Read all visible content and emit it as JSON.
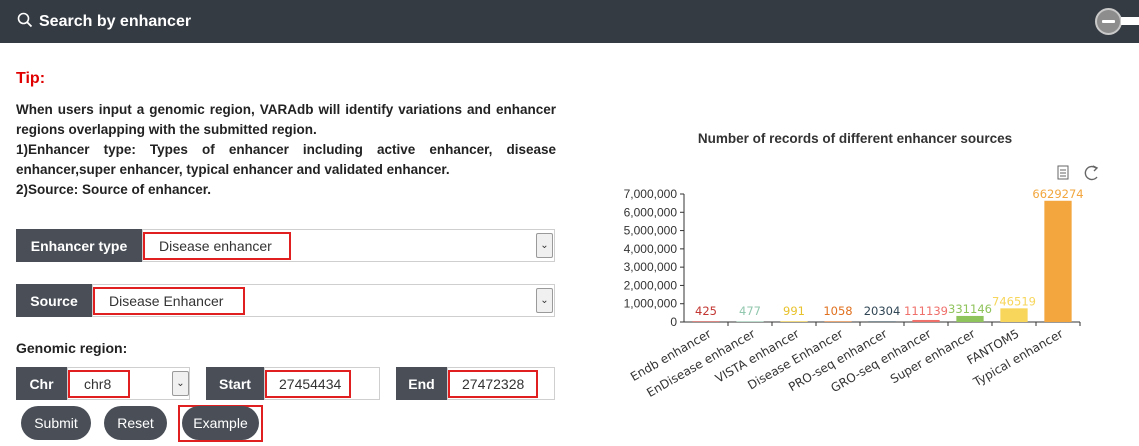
{
  "header": {
    "title": "Search by enhancer"
  },
  "tip": {
    "title": "Tip:",
    "lines": [
      "When users input a genomic region, VARAdb will identify variations and enhancer regions overlapping with the submitted region.",
      "1)Enhancer type: Types of enhancer including active enhancer, disease enhancer,super enhancer, typical enhancer and validated enhancer.",
      "2)Source: Source of enhancer."
    ]
  },
  "form": {
    "enhancer_type": {
      "label": "Enhancer type",
      "value": "Disease enhancer"
    },
    "source": {
      "label": "Source",
      "value": "Disease Enhancer"
    },
    "genomic_region_label": "Genomic region:",
    "chr": {
      "label": "Chr",
      "value": "chr8"
    },
    "start": {
      "label": "Start",
      "value": "27454434"
    },
    "end": {
      "label": "End",
      "value": "27472328"
    }
  },
  "buttons": {
    "submit": "Submit",
    "reset": "Reset",
    "example": "Example"
  },
  "icons": {
    "search": "search-icon",
    "collapse": "minus-circle-icon",
    "data_view": "document-icon",
    "restore": "refresh-icon",
    "dropdown": "chevron-down-icon"
  },
  "colors": {
    "header_bg": "#353b43",
    "label_bg": "#4a4f57",
    "highlight": "#e02020",
    "tip": "#e00000"
  },
  "chart_data": {
    "type": "bar",
    "title": "Number of records of different enhancer sources",
    "categories": [
      "Endb enhancer",
      "EnDisease enhancer",
      "VISTA enhancer",
      "Disease Enhancer",
      "PRO-seq  enhancer",
      "GRO-seq enhancer",
      "Super enhancer",
      "FANTOM5",
      "Typical enhancer"
    ],
    "values": [
      425,
      477,
      991,
      1058,
      20304,
      111139,
      331146,
      746519,
      6629274
    ],
    "colors": [
      "#c23531",
      "#91c7ae",
      "#e8c22c",
      "#e0701f",
      "#2f4554",
      "#ef6f6a",
      "#8fc35b",
      "#f7d65b",
      "#f2a63d"
    ],
    "yticks": [
      "0",
      "1,000,000",
      "2,000,000",
      "3,000,000",
      "4,000,000",
      "5,000,000",
      "6,000,000",
      "7,000,000"
    ],
    "ylim": [
      0,
      7000000
    ],
    "grid": false
  }
}
